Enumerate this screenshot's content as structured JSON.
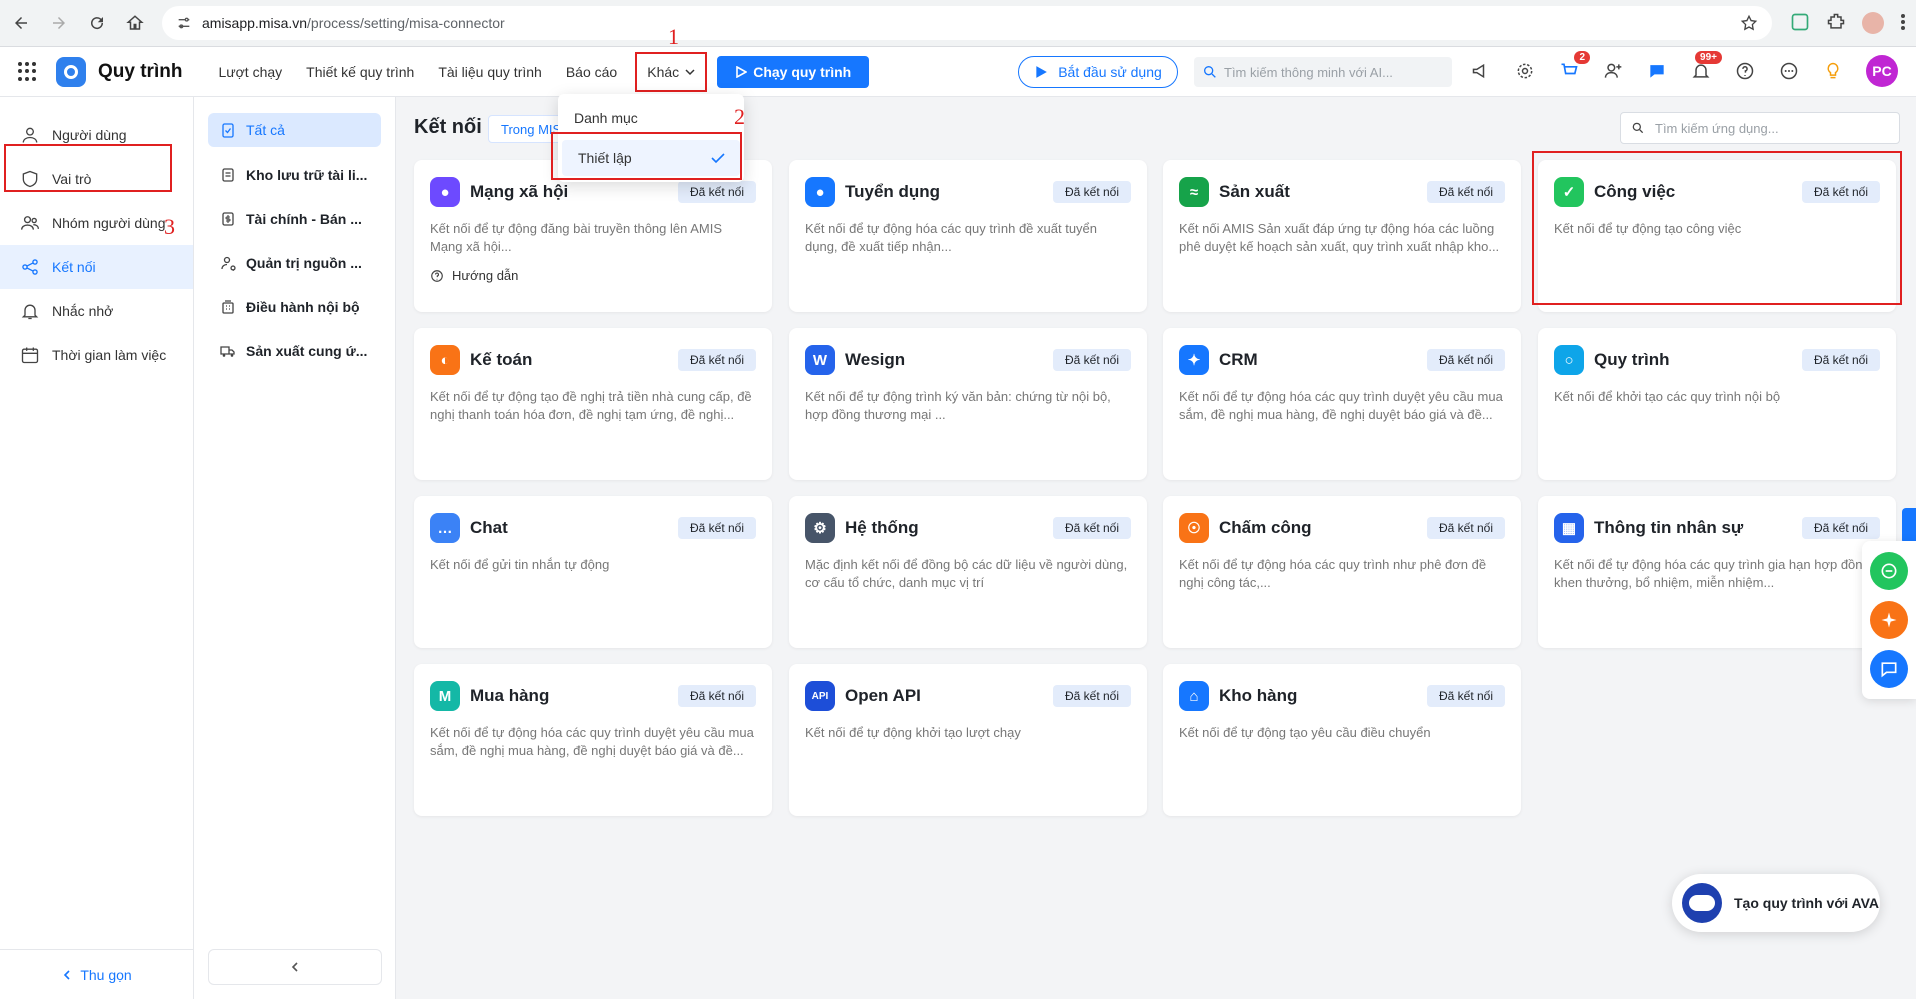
{
  "browser": {
    "url_host": "amisapp.misa.vn",
    "url_path": "/process/setting/misa-connector"
  },
  "header": {
    "app_title": "Quy trình",
    "nav": [
      "Lượt chạy",
      "Thiết kế quy trình",
      "Tài liệu quy trình",
      "Báo cáo"
    ],
    "more_label": "Khác",
    "run_button": "Chạy quy trình",
    "start_button": "Bắt đầu sử dụng",
    "search_placeholder": "Tìm kiếm thông minh với AI...",
    "cart_badge": "2",
    "notif_badge": "99+",
    "avatar_initials": "PC"
  },
  "dropdown": {
    "items": [
      "Danh mục",
      "Thiết lập"
    ]
  },
  "annotations": [
    "1",
    "2",
    "3"
  ],
  "sidebar": {
    "items": [
      "Người dùng",
      "Vai trò",
      "Nhóm người dùng",
      "Kết nối",
      "Nhắc nhở",
      "Thời gian làm việc"
    ],
    "collapse_label": "Thu gọn"
  },
  "categories": {
    "items": [
      "Tất cả",
      "Kho lưu trữ tài li...",
      "Tài chính - Bán ...",
      "Quản trị nguồn ...",
      "Điều hành nội bộ",
      "Sản xuất cung ứ..."
    ]
  },
  "main": {
    "title": "Kết nối",
    "scope_tab": "Trong MIS",
    "search_placeholder": "Tìm kiếm ứng dụng...",
    "status_label": "Đã kết nối",
    "guide_label": "Hướng dẫn",
    "cards": [
      {
        "title": "Mạng xã hội",
        "desc": "Kết nối để tự động đăng bài truyền thông lên AMIS Mạng xã hội...",
        "color": "#6d4aff"
      },
      {
        "title": "Tuyển dụng",
        "desc": "Kết nối để tự động hóa các quy trình đề xuất tuyển dụng, đề xuất tiếp nhận...",
        "color": "#1677ff"
      },
      {
        "title": "Sản xuất",
        "desc": "Kết nối AMIS Sản xuất đáp ứng tự động hóa các luồng phê duyệt kế hoạch sản xuất, quy trình xuất nhập kho...",
        "color": "#16a34a"
      },
      {
        "title": "Công việc",
        "desc": "Kết nối để tự động tạo công việc",
        "color": "#22c55e"
      },
      {
        "title": "Kế toán",
        "desc": "Kết nối để tự động tạo đề nghị trả tiền nhà cung cấp, đề nghị thanh toán hóa đơn, đề nghị tạm ứng, đề nghị...",
        "color": "#f97316"
      },
      {
        "title": "Wesign",
        "desc": "Kết nối để tự động trình ký văn bản: chứng từ nội bộ, hợp đồng thương mại ...",
        "color": "#2563eb"
      },
      {
        "title": "CRM",
        "desc": "Kết nối để tự động hóa các quy trình duyệt yêu cầu mua sắm, đề nghị mua hàng, đề nghị duyệt báo giá và đề...",
        "color": "#1677ff"
      },
      {
        "title": "Quy trình",
        "desc": "Kết nối để khởi tạo các quy trình nội bộ",
        "color": "#0ea5e9"
      },
      {
        "title": "Chat",
        "desc": "Kết nối để gửi tin nhắn tự động",
        "color": "#3b82f6"
      },
      {
        "title": "Hệ thống",
        "desc": "Mặc định kết nối để đồng bộ các dữ liệu về người dùng, cơ cấu tổ chức, danh mục vị trí",
        "color": "#475569"
      },
      {
        "title": "Chấm công",
        "desc": "Kết nối để tự động hóa các quy trình như phê đơn đề nghị công tác,...",
        "color": "#f97316"
      },
      {
        "title": "Thông tin nhân sự",
        "desc": "Kết nối để tự động hóa các quy trình gia hạn hợp đồng, khen thưởng, bổ nhiệm, miễn nhiệm...",
        "color": "#2563eb"
      },
      {
        "title": "Mua hàng",
        "desc": "Kết nối để tự động hóa các quy trình duyệt yêu cầu mua sắm, đề nghị mua hàng, đề nghị duyệt báo giá và đề...",
        "color": "#14b8a6"
      },
      {
        "title": "Open API",
        "desc": "Kết nối để tự động khởi tạo lượt chạy",
        "color": "#1d4ed8"
      },
      {
        "title": "Kho hàng",
        "desc": "Kết nối để tự động tạo yêu cầu điều chuyển",
        "color": "#1677ff"
      }
    ]
  },
  "ava_button": "Tạo quy trình với AVA"
}
